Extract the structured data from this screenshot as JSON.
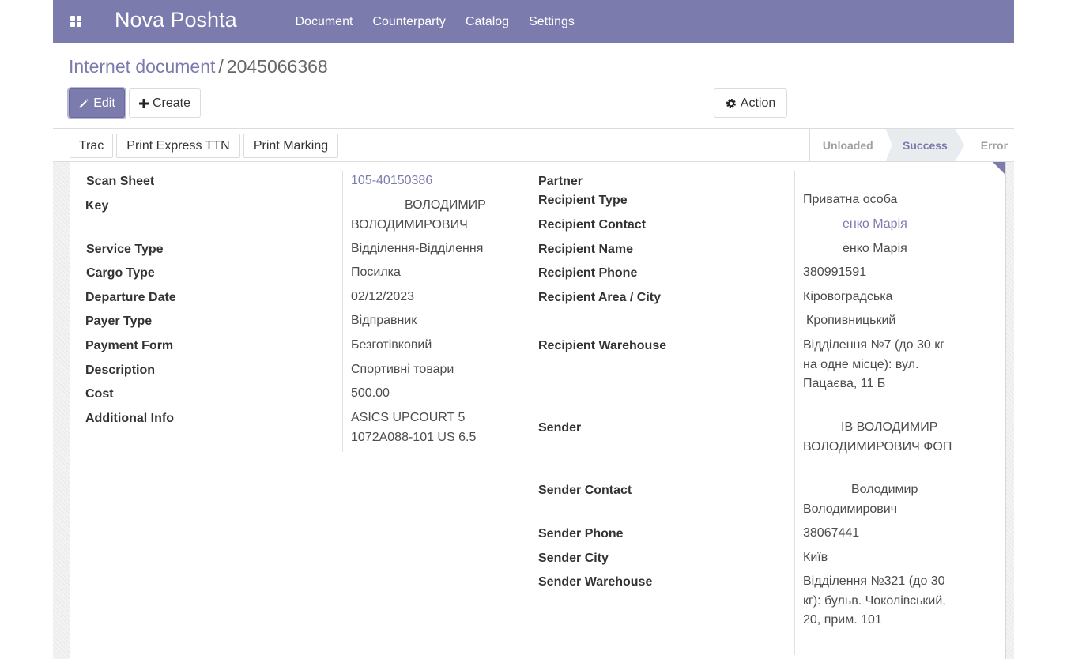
{
  "navbar": {
    "brand": "Nova Poshta",
    "menu": [
      "Document",
      "Counterparty",
      "Catalog",
      "Settings"
    ]
  },
  "breadcrumb": {
    "parent": "Internet document",
    "separator": "/",
    "current": "2045066368"
  },
  "buttons": {
    "edit": "Edit",
    "create": "Create",
    "action": "Action"
  },
  "header_buttons": [
    "Trac",
    "Print Express TTN",
    "Print Marking"
  ],
  "statusbar": {
    "steps": [
      "Unloaded",
      "Success",
      "Error"
    ],
    "active": "Success"
  },
  "left_fields": [
    {
      "label": "Scan Sheet",
      "value": "105-40150386"
    },
    {
      "label": "Key",
      "value": "ВОЛОДИМИР ВОЛОДИМИРОВИЧ"
    },
    {
      "label": "Service Type",
      "value": "Відділення-Відділення"
    },
    {
      "label": "Cargo Type",
      "value": "Посилка"
    },
    {
      "label": "Departure Date",
      "value": "02/12/2023"
    },
    {
      "label": "Payer Type",
      "value": "Відправник"
    },
    {
      "label": "Payment Form",
      "value": "Безготівковий"
    },
    {
      "label": "Description",
      "value": "Спортивні товари"
    },
    {
      "label": "Cost",
      "value": "500.00"
    },
    {
      "label": "Additional Info",
      "value": "ASICS UPCOURT 5 1072A088-101 US 6.5"
    }
  ],
  "right_fields": [
    {
      "label": "Partner",
      "value": ""
    },
    {
      "label": "Recipient Type",
      "value": "Приватна особа"
    },
    {
      "label": "Recipient Contact",
      "value": "енко Марія"
    },
    {
      "label": "Recipient Name",
      "value": "енко Марія"
    },
    {
      "label": "Recipient Phone",
      "value": "380991591"
    },
    {
      "label": "Recipient Area / City",
      "value": "Кіровоградська"
    },
    {
      "label": "",
      "value": "Кропивницький"
    },
    {
      "label": "Recipient Warehouse",
      "value": "Відділення №7 (до 30 кг на одне місце): вул. Пацаєва, 11 Б"
    },
    {
      "label": "Sender",
      "value": "ІВ ВОЛОДИМИР ВОЛОДИМИРОВИЧ ФОП"
    },
    {
      "label": "Sender Contact",
      "value": "Володимир Володимирович"
    },
    {
      "label": "Sender Phone",
      "value": "38067441"
    },
    {
      "label": "Sender City",
      "value": "Київ"
    },
    {
      "label": "Sender Warehouse",
      "value": "Відділення №321 (до 30 кг): бульв. Чоколівський, 20, прим. 101"
    }
  ],
  "colors": {
    "brand": "#7c7bad",
    "navbar_text": "#ffffff"
  }
}
